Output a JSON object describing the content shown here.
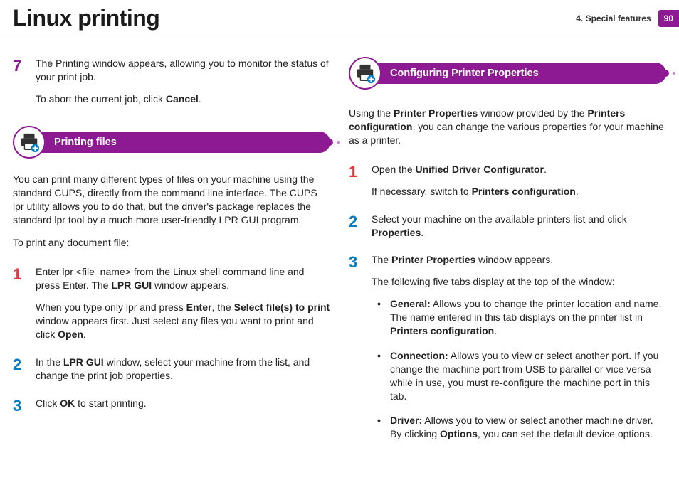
{
  "header": {
    "title": "Linux printing",
    "chapter": "4.   Special features",
    "page": "90"
  },
  "left": {
    "step7": {
      "num": "7",
      "p1a": "The Printing window appears, allowing you to monitor the status of your print job.",
      "p2a": "To abort the current job, click ",
      "p2b": "Cancel",
      "p2c": "."
    },
    "section": "Printing files",
    "intro1": "You can print many different types of files on your machine using the standard CUPS, directly from the command line interface. The CUPS lpr utility allows you to do that, but the driver's package replaces the standard lpr tool by a much more user-friendly LPR GUI program.",
    "intro2": "To print any document file:",
    "s1": {
      "num": "1",
      "p1a": "Enter lpr <file_name> from the Linux shell command line and press Enter. The ",
      "p1b": "LPR GUI",
      "p1c": " window appears.",
      "p2a": "When you type only lpr and press ",
      "p2b": "Enter",
      "p2c": ", the ",
      "p2d": "Select file(s) to print",
      "p2e": " window appears first. Just select any files you want to print and click ",
      "p2f": "Open",
      "p2g": "."
    },
    "s2": {
      "num": "2",
      "p1a": "In the ",
      "p1b": "LPR GUI",
      "p1c": " window, select your machine from the list, and change the print job properties."
    },
    "s3": {
      "num": "3",
      "p1a": "Click ",
      "p1b": "OK",
      "p1c": " to start printing."
    }
  },
  "right": {
    "section": "Configuring Printer Properties",
    "intro_a": "Using the ",
    "intro_b": "Printer Properties",
    "intro_c": " window provided by the ",
    "intro_d": "Printers configuration",
    "intro_e": ", you can change the various properties for your machine as a printer.",
    "s1": {
      "num": "1",
      "p1a": "Open the ",
      "p1b": "Unified Driver Configurator",
      "p1c": ".",
      "p2a": "If necessary, switch to ",
      "p2b": "Printers configuration",
      "p2c": "."
    },
    "s2": {
      "num": "2",
      "p1a": "Select your machine on the available printers list and click ",
      "p1b": "Properties",
      "p1c": "."
    },
    "s3": {
      "num": "3",
      "p1a": "The ",
      "p1b": "Printer Properties",
      "p1c": " window appears.",
      "p2": "The following five tabs display at the top of the window:",
      "b1a": "General:",
      "b1b": " Allows you to change the printer location and name. The name entered in this tab displays on the printer list in ",
      "b1c": "Printers configuration",
      "b1d": ".",
      "b2a": "Connection:",
      "b2b": " Allows you to view or select another port. If you change the machine port from USB to parallel or vice versa while in use, you must re-configure the machine port in this tab.",
      "b3a": "Driver:",
      "b3b": " Allows you to view or select another machine driver. By clicking ",
      "b3c": "Options",
      "b3d": ", you can set the default device options."
    }
  }
}
